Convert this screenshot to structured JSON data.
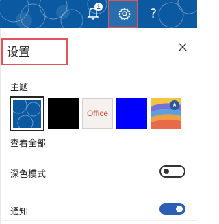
{
  "header": {
    "notification_count": "1",
    "help_label": "?"
  },
  "panel": {
    "title": "设置"
  },
  "theme_section": {
    "label": "主题",
    "themes": [
      {
        "name": "blue-circles",
        "selected": true
      },
      {
        "name": "black"
      },
      {
        "name": "office",
        "text": "Office"
      },
      {
        "name": "blue"
      },
      {
        "name": "rainbow"
      }
    ],
    "view_all": "查看全部"
  },
  "settings": {
    "dark_mode": {
      "label": "深色模式",
      "on": false
    },
    "notifications": {
      "label": "通知",
      "on": true
    }
  },
  "colors": {
    "header_bg": "#0b5aa1",
    "highlight_border": "#e1545b",
    "toggle_on": "#2b5fb3"
  },
  "icons": [
    "bell-icon",
    "gear-icon",
    "help-icon",
    "close-icon",
    "star-icon"
  ]
}
